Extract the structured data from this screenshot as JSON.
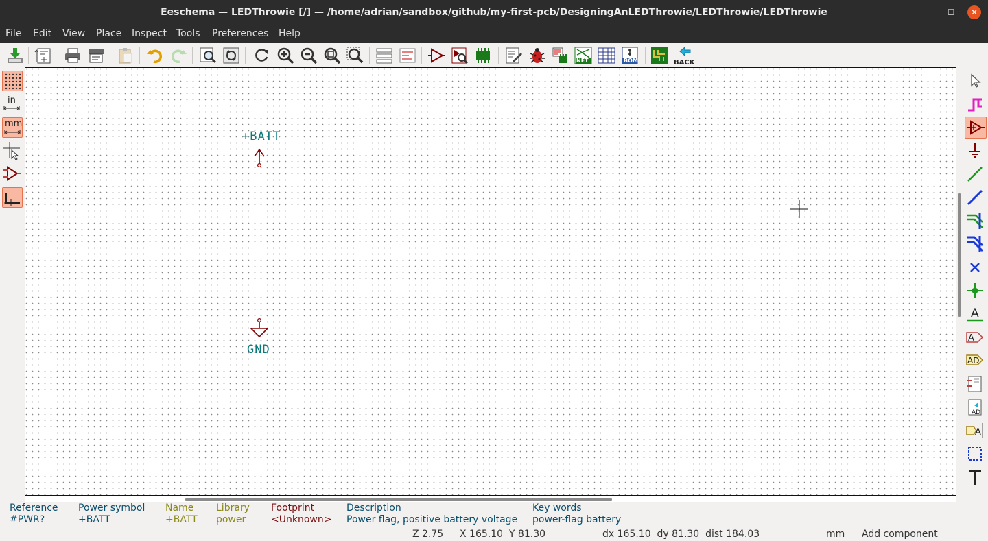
{
  "window": {
    "title": "Eeschema — LEDThrowie [/] — /home/adrian/sandbox/github/my-first-pcb/DesigningAnLEDThrowie/LEDThrowie/LEDThrowie"
  },
  "menu": [
    "File",
    "Edit",
    "View",
    "Place",
    "Inspect",
    "Tools",
    "Preferences",
    "Help"
  ],
  "toolbar": {
    "back_label": "BACK",
    "net_label": "NET",
    "bom_label": "BOM"
  },
  "left_toolbar": {
    "inch_label": "in",
    "mm_label": "mm"
  },
  "canvas": {
    "symbols": [
      {
        "value": "+BATT",
        "kind": "power-arrow"
      },
      {
        "value": "GND",
        "kind": "ground"
      }
    ]
  },
  "message_panel": [
    {
      "label": "Reference",
      "value": "#PWR?",
      "color": "#0b4f6c"
    },
    {
      "label": "Power symbol",
      "value": "+BATT",
      "color": "#0b4f6c"
    },
    {
      "label": "Name",
      "value": "+BATT",
      "color": "#8a8a1a"
    },
    {
      "label": "Library",
      "value": "power",
      "color": "#8a8a1a"
    },
    {
      "label": "Footprint",
      "value": "<Unknown>",
      "color": "#7a1010"
    },
    {
      "label": "Description",
      "value": "Power flag, positive battery voltage",
      "color": "#0b4f6c"
    },
    {
      "label": "Key words",
      "value": "power-flag battery",
      "color": "#0b4f6c"
    }
  ],
  "status": {
    "zoom": "Z 2.75",
    "xy": "X 165.10  Y 81.30",
    "delta": "dx 165.10  dy 81.30  dist 184.03",
    "units": "mm",
    "mode": "Add component"
  },
  "colors": {
    "accent_toggle": "#f9b8a2",
    "symbol_red": "#840000",
    "label_teal": "#0a7a7a"
  }
}
